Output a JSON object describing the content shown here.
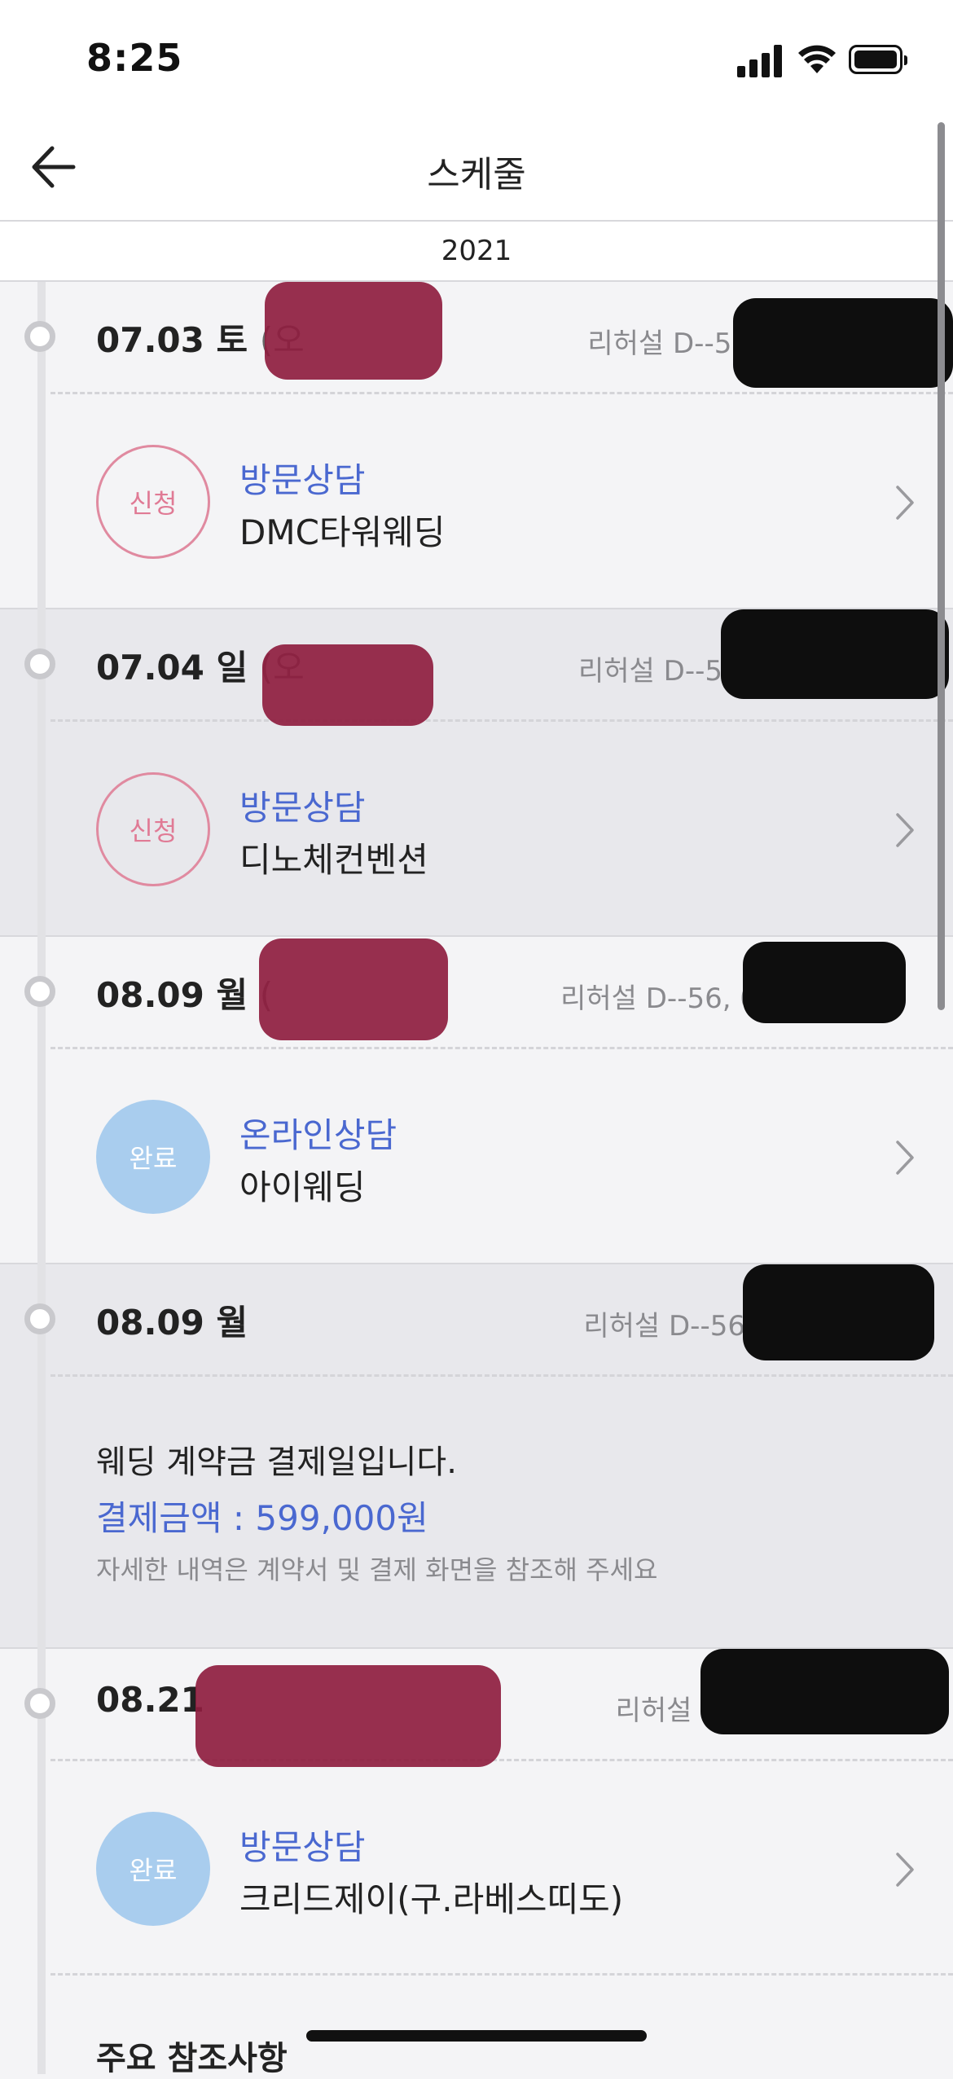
{
  "status_bar": {
    "time": "8:25"
  },
  "nav": {
    "title": "스케줄"
  },
  "year": "2021",
  "entries": [
    {
      "date": "07.03 토",
      "paren": "(오",
      "dday": "리허설 D--56",
      "badge": "신청",
      "category": "방문상담",
      "place": "DMC타워웨딩"
    },
    {
      "date": "07.04 일",
      "paren": "(오",
      "dday": "리허설 D--5",
      "badge": "신청",
      "category": "방문상담",
      "place": "디노체컨벤션"
    },
    {
      "date": "08.09 월",
      "paren": "(",
      "dday": "리허설 D--56, 0",
      "badge": "완료",
      "category": "온라인상담",
      "place": "아이웨딩"
    },
    {
      "date": "08.09 월",
      "dday": "리허설 D--56",
      "memo": {
        "main": "웨딩 계약금 결제일입니다.",
        "amount": "결제금액 : 599,000원",
        "note": "자세한 내역은 계약서 및 결제 화면을 참조해 주세요"
      }
    },
    {
      "date": "08.21",
      "dday": "리허설 D--56,",
      "badge": "완료",
      "category": "방문상담",
      "place": "크리드제이(구.라베스띠도)"
    }
  ],
  "notice": {
    "title": "주요 참조사항"
  }
}
